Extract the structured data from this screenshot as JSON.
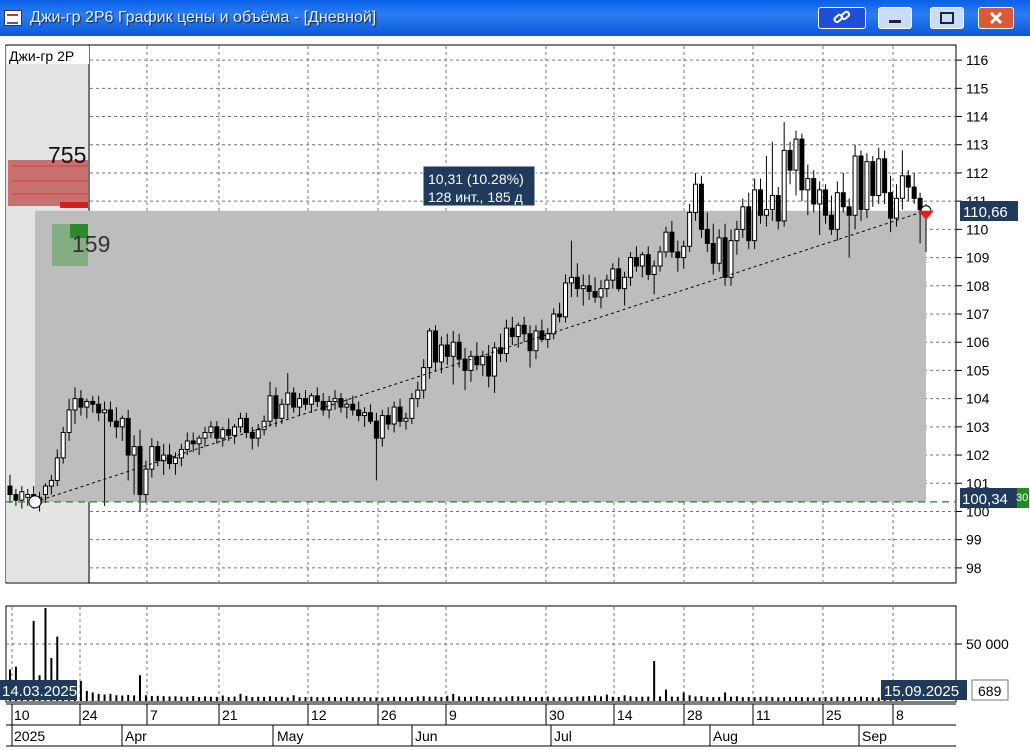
{
  "window": {
    "title": "Джи-гр 2Р6 График цены и объёма - [Дневной]"
  },
  "instrument_label": "Джи-гр 2Р",
  "order_book": {
    "ask_volume": "755",
    "bid_volume": "159"
  },
  "measure_tooltip": {
    "line1": "10,31 (10.28%)",
    "line2": "128 инт., 185 д"
  },
  "price_axis": {
    "ticks": [
      "116",
      "115",
      "114",
      "113",
      "112",
      "111",
      "110",
      "109",
      "108",
      "107",
      "106",
      "105",
      "104",
      "103",
      "102",
      "101",
      "100",
      "99",
      "98"
    ],
    "current_price_label": "110,66",
    "level_label": "100,34",
    "level_tag": "30"
  },
  "volume_axis": {
    "ticks": [
      "50 000"
    ],
    "last_volume": "689"
  },
  "date_range": {
    "start": "14.03.2025",
    "end": "15.09.2025"
  },
  "time_axis": {
    "days": [
      "10",
      "24",
      "7",
      "21",
      "12",
      "26",
      "9",
      "30",
      "14",
      "28",
      "11",
      "25",
      "8"
    ],
    "months": [
      "2025",
      "Apr",
      "May",
      "Jun",
      "Jul",
      "Aug",
      "Sep"
    ]
  },
  "colors": {
    "accent_red": "#e51c1c",
    "level_green": "#1a8f1a",
    "label_bg": "#1f3a5a"
  },
  "chart_data": {
    "type": "candlestick",
    "y_range": [
      97.5,
      116.5
    ],
    "candles": [
      [
        100.9,
        101.3,
        100.3,
        100.6
      ],
      [
        100.6,
        100.8,
        100.2,
        100.4
      ],
      [
        100.4,
        100.9,
        100.1,
        100.7
      ],
      [
        100.5,
        100.8,
        100.2,
        100.6
      ],
      [
        100.6,
        100.9,
        100.1,
        100.3
      ],
      [
        100.3,
        100.7,
        100.0,
        100.5
      ],
      [
        100.6,
        101.0,
        100.3,
        100.9
      ],
      [
        100.9,
        101.3,
        100.6,
        101.1
      ],
      [
        101.1,
        102.2,
        100.9,
        101.9
      ],
      [
        101.9,
        103.0,
        101.7,
        102.8
      ],
      [
        102.8,
        104.0,
        102.5,
        103.6
      ],
      [
        103.6,
        104.4,
        103.1,
        104.0
      ],
      [
        104.0,
        104.3,
        103.4,
        103.7
      ],
      [
        103.7,
        104.0,
        103.3,
        103.9
      ],
      [
        103.9,
        104.1,
        103.5,
        103.8
      ],
      [
        103.8,
        104.1,
        103.2,
        103.5
      ],
      [
        103.5,
        103.9,
        100.2,
        103.6
      ],
      [
        103.6,
        103.9,
        103.0,
        103.2
      ],
      [
        103.2,
        103.7,
        102.6,
        103.0
      ],
      [
        103.0,
        103.4,
        102.5,
        103.3
      ],
      [
        103.3,
        103.6,
        101.1,
        102.0
      ],
      [
        102.0,
        102.7,
        100.6,
        102.3
      ],
      [
        102.3,
        102.9,
        100.0,
        100.6
      ],
      [
        100.6,
        101.8,
        100.3,
        101.5
      ],
      [
        101.5,
        102.6,
        101.2,
        102.3
      ],
      [
        102.3,
        102.5,
        101.6,
        101.8
      ],
      [
        101.8,
        102.4,
        101.3,
        102.0
      ],
      [
        102.0,
        102.4,
        101.5,
        101.7
      ],
      [
        101.7,
        102.1,
        101.3,
        101.9
      ],
      [
        101.9,
        102.4,
        101.6,
        102.2
      ],
      [
        102.2,
        102.8,
        102.0,
        102.5
      ],
      [
        102.5,
        102.8,
        102.1,
        102.4
      ],
      [
        102.4,
        102.7,
        102.0,
        102.6
      ],
      [
        102.6,
        103.0,
        102.3,
        102.8
      ],
      [
        102.8,
        103.2,
        102.6,
        103.0
      ],
      [
        103.0,
        103.2,
        102.4,
        102.6
      ],
      [
        102.6,
        103.0,
        102.3,
        102.9
      ],
      [
        102.9,
        103.3,
        102.5,
        102.7
      ],
      [
        102.7,
        103.1,
        102.4,
        103.0
      ],
      [
        103.0,
        103.5,
        102.8,
        103.3
      ],
      [
        103.3,
        103.5,
        102.6,
        102.8
      ],
      [
        102.8,
        103.0,
        102.2,
        102.6
      ],
      [
        102.6,
        103.1,
        102.3,
        102.9
      ],
      [
        102.9,
        103.4,
        102.7,
        103.2
      ],
      [
        103.2,
        104.6,
        103.0,
        104.1
      ],
      [
        104.1,
        104.4,
        103.0,
        103.3
      ],
      [
        103.3,
        104.0,
        103.1,
        103.8
      ],
      [
        103.8,
        104.9,
        103.3,
        104.2
      ],
      [
        104.2,
        104.4,
        103.5,
        103.7
      ],
      [
        103.7,
        104.2,
        103.4,
        104.0
      ],
      [
        104.0,
        104.3,
        103.6,
        103.8
      ],
      [
        103.8,
        104.2,
        103.5,
        104.1
      ],
      [
        104.1,
        104.4,
        103.7,
        103.9
      ],
      [
        103.9,
        104.2,
        103.4,
        103.6
      ],
      [
        103.6,
        104.1,
        103.3,
        103.9
      ],
      [
        103.9,
        104.3,
        103.6,
        104.0
      ],
      [
        104.0,
        104.2,
        103.5,
        103.7
      ],
      [
        103.7,
        104.0,
        103.3,
        103.8
      ],
      [
        103.8,
        104.1,
        103.4,
        103.6
      ],
      [
        103.6,
        103.9,
        103.2,
        103.4
      ],
      [
        103.4,
        103.7,
        103.0,
        103.5
      ],
      [
        103.5,
        103.8,
        103.1,
        103.2
      ],
      [
        103.2,
        103.5,
        101.1,
        102.6
      ],
      [
        102.6,
        103.6,
        102.3,
        103.4
      ],
      [
        103.4,
        103.7,
        102.9,
        103.1
      ],
      [
        103.1,
        103.9,
        102.8,
        103.7
      ],
      [
        103.7,
        104.0,
        103.0,
        103.2
      ],
      [
        103.2,
        103.5,
        102.9,
        103.3
      ],
      [
        103.3,
        104.2,
        103.1,
        104.0
      ],
      [
        104.0,
        104.6,
        103.7,
        104.3
      ],
      [
        104.3,
        105.4,
        104.0,
        105.1
      ],
      [
        105.1,
        106.5,
        104.7,
        106.4
      ],
      [
        106.4,
        106.6,
        105.0,
        105.3
      ],
      [
        105.3,
        106.2,
        104.9,
        105.9
      ],
      [
        105.9,
        106.3,
        105.2,
        105.5
      ],
      [
        105.5,
        106.4,
        104.5,
        106.0
      ],
      [
        106.0,
        106.3,
        105.1,
        105.4
      ],
      [
        105.4,
        105.8,
        104.3,
        105.0
      ],
      [
        105.0,
        105.7,
        104.6,
        105.5
      ],
      [
        105.5,
        106.0,
        105.0,
        105.2
      ],
      [
        105.2,
        105.7,
        104.8,
        105.5
      ],
      [
        105.5,
        105.9,
        104.4,
        104.8
      ],
      [
        104.8,
        106.0,
        104.2,
        105.8
      ],
      [
        105.8,
        106.3,
        105.3,
        105.6
      ],
      [
        105.6,
        106.8,
        105.3,
        106.5
      ],
      [
        106.5,
        106.9,
        105.9,
        106.2
      ],
      [
        106.2,
        106.7,
        105.8,
        106.6
      ],
      [
        106.6,
        106.9,
        106.0,
        106.3
      ],
      [
        106.3,
        106.6,
        105.1,
        105.7
      ],
      [
        105.7,
        106.6,
        105.4,
        106.4
      ],
      [
        106.4,
        106.8,
        106.0,
        106.1
      ],
      [
        106.1,
        106.5,
        105.8,
        106.3
      ],
      [
        106.3,
        107.2,
        106.1,
        107.0
      ],
      [
        107.0,
        107.4,
        106.7,
        106.9
      ],
      [
        106.9,
        108.4,
        106.7,
        108.1
      ],
      [
        108.1,
        109.6,
        107.6,
        108.3
      ],
      [
        108.3,
        108.8,
        107.6,
        107.9
      ],
      [
        107.9,
        108.4,
        107.3,
        108.0
      ],
      [
        108.0,
        108.4,
        107.5,
        107.8
      ],
      [
        107.8,
        108.3,
        107.4,
        107.6
      ],
      [
        107.6,
        108.2,
        107.2,
        107.9
      ],
      [
        107.9,
        108.4,
        107.6,
        108.2
      ],
      [
        108.2,
        108.8,
        107.9,
        108.6
      ],
      [
        108.6,
        109.0,
        107.8,
        107.9
      ],
      [
        107.9,
        108.5,
        107.3,
        108.3
      ],
      [
        108.3,
        109.2,
        108.0,
        109.0
      ],
      [
        109.0,
        109.4,
        108.5,
        108.7
      ],
      [
        108.7,
        109.2,
        108.3,
        109.1
      ],
      [
        109.1,
        109.4,
        108.2,
        108.4
      ],
      [
        108.4,
        108.9,
        107.7,
        108.7
      ],
      [
        108.7,
        109.4,
        108.5,
        109.2
      ],
      [
        109.2,
        110.1,
        109.0,
        109.9
      ],
      [
        109.9,
        110.3,
        109.0,
        109.2
      ],
      [
        109.2,
        109.6,
        108.5,
        109.0
      ],
      [
        109.0,
        109.6,
        108.6,
        109.4
      ],
      [
        109.4,
        110.9,
        109.2,
        110.6
      ],
      [
        110.6,
        112.0,
        110.3,
        111.6
      ],
      [
        111.6,
        111.9,
        109.7,
        110.0
      ],
      [
        110.0,
        110.6,
        109.2,
        109.5
      ],
      [
        109.5,
        110.2,
        108.4,
        108.8
      ],
      [
        108.8,
        110.0,
        108.5,
        109.7
      ],
      [
        109.7,
        110.2,
        108.0,
        108.3
      ],
      [
        108.3,
        110.0,
        108.0,
        109.6
      ],
      [
        109.6,
        110.3,
        109.1,
        110.0
      ],
      [
        110.0,
        111.1,
        109.7,
        110.8
      ],
      [
        110.8,
        111.3,
        109.3,
        109.6
      ],
      [
        109.6,
        111.8,
        109.3,
        111.4
      ],
      [
        111.4,
        111.8,
        110.2,
        110.5
      ],
      [
        110.5,
        112.6,
        110.1,
        110.7
      ],
      [
        110.7,
        113.1,
        110.3,
        111.2
      ],
      [
        111.2,
        111.5,
        110.0,
        110.3
      ],
      [
        110.3,
        113.8,
        110.1,
        112.8
      ],
      [
        112.8,
        113.1,
        111.6,
        112.1
      ],
      [
        112.1,
        113.5,
        111.2,
        113.2
      ],
      [
        113.2,
        113.4,
        111.0,
        111.4
      ],
      [
        111.4,
        112.3,
        110.5,
        111.8
      ],
      [
        111.8,
        112.1,
        110.6,
        110.9
      ],
      [
        110.9,
        111.7,
        109.8,
        111.4
      ],
      [
        111.4,
        111.6,
        110.2,
        110.5
      ],
      [
        110.5,
        111.2,
        109.8,
        110.0
      ],
      [
        110.0,
        111.7,
        109.6,
        111.3
      ],
      [
        111.3,
        112.0,
        110.6,
        110.8
      ],
      [
        110.8,
        111.1,
        109.0,
        110.5
      ],
      [
        110.5,
        113.0,
        110.0,
        112.6
      ],
      [
        112.6,
        112.8,
        110.3,
        110.7
      ],
      [
        110.7,
        112.7,
        110.4,
        112.4
      ],
      [
        112.4,
        112.6,
        110.8,
        111.2
      ],
      [
        111.2,
        112.9,
        110.9,
        112.5
      ],
      [
        112.5,
        112.8,
        110.9,
        111.3
      ],
      [
        111.3,
        111.9,
        109.9,
        110.4
      ],
      [
        110.4,
        111.6,
        110.1,
        111.1
      ],
      [
        111.1,
        112.8,
        110.7,
        111.9
      ],
      [
        111.9,
        112.1,
        111.0,
        111.5
      ],
      [
        111.5,
        112.0,
        110.9,
        111.1
      ],
      [
        111.1,
        111.3,
        109.5,
        110.7
      ],
      [
        110.7,
        110.9,
        109.2,
        110.66
      ]
    ],
    "volume_max": 65000,
    "volume": [
      22000,
      24000,
      12000,
      8000,
      56000,
      18000,
      65000,
      30000,
      45000,
      12000,
      10000,
      8000,
      14000,
      7000,
      6000,
      5000,
      4500,
      5000,
      4000,
      3800,
      4200,
      3900,
      18000,
      4000,
      3500,
      3600,
      3400,
      3200,
      3300,
      3100,
      3000,
      3500,
      2800,
      3200,
      3000,
      2900,
      3800,
      2700,
      3100,
      5000,
      3600,
      2800,
      3000,
      2900,
      3300,
      2700,
      3000,
      2500,
      4000,
      2600,
      2800,
      3000,
      2700,
      2600,
      2900,
      2800,
      2500,
      3000,
      2600,
      2700,
      2800,
      2600,
      2500,
      2400,
      2700,
      3000,
      2900,
      2600,
      2800,
      3200,
      3300,
      3000,
      3100,
      2800,
      3600,
      5000,
      3200,
      2900,
      3000,
      3400,
      2800,
      2700,
      2900,
      2600,
      3000,
      3400,
      3200,
      3100,
      2800,
      2700,
      2900,
      3100,
      2600,
      2700,
      3000,
      2800,
      3100,
      3300,
      3500,
      3800,
      3200,
      4500,
      3000,
      2800,
      4000,
      3300,
      2900,
      3000,
      3100,
      28000,
      3200,
      8000,
      3100,
      3000,
      6000,
      4000,
      3200,
      3500,
      2900,
      2700,
      2800,
      6000,
      3000,
      3300,
      2700,
      2800,
      2600,
      2900,
      3100,
      2700,
      2500,
      2600,
      2800,
      2900,
      2700,
      2600,
      2400,
      2500,
      2800,
      2600,
      3000,
      2700,
      2900,
      2800,
      3100,
      2700,
      2600,
      2500,
      2900,
      3200,
      2700,
      689
    ]
  }
}
